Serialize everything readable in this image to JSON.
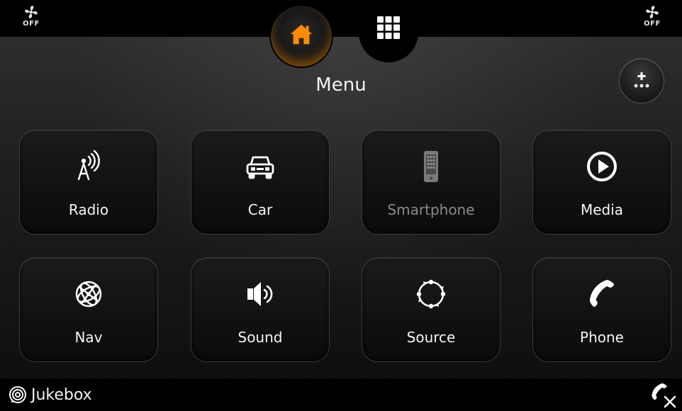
{
  "header": {
    "fan_left": {
      "icon": "fan-icon",
      "label": "OFF"
    },
    "fan_right": {
      "icon": "fan-icon",
      "label": "OFF"
    },
    "home_tab_icon": "home-icon",
    "apps_tab_icon": "grid-icon",
    "title": "Menu",
    "add_shortcut_icon": "plus-dots-icon"
  },
  "tiles": [
    {
      "label": "Radio",
      "icon": "radio-antenna-icon",
      "enabled": true
    },
    {
      "label": "Car",
      "icon": "car-icon",
      "enabled": true
    },
    {
      "label": "Smartphone",
      "icon": "smartphone-icon",
      "enabled": false
    },
    {
      "label": "Media",
      "icon": "play-circle-icon",
      "enabled": true
    },
    {
      "label": "Nav",
      "icon": "globe-icon",
      "enabled": true
    },
    {
      "label": "Sound",
      "icon": "speaker-icon",
      "enabled": true
    },
    {
      "label": "Source",
      "icon": "source-cycle-icon",
      "enabled": true
    },
    {
      "label": "Phone",
      "icon": "phone-icon",
      "enabled": true
    }
  ],
  "footer": {
    "source_icon": "disc-icon",
    "source_label": "Jukebox",
    "call_icon": "phone-disconnected-icon"
  },
  "colors": {
    "accent": "#ff8c00",
    "text": "#f4f4f4",
    "disabled_text": "#8a8a8a",
    "background": "#000000"
  }
}
